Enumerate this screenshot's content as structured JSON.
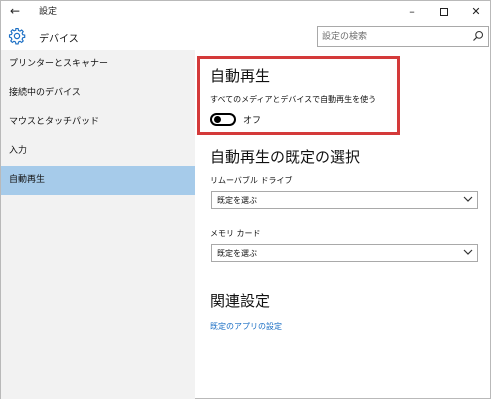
{
  "window": {
    "title": "設定"
  },
  "header": {
    "title": "デバイス",
    "search_placeholder": "設定の検索"
  },
  "sidebar": {
    "items": [
      {
        "label": "プリンターとスキャナー"
      },
      {
        "label": "接続中のデバイス"
      },
      {
        "label": "マウスとタッチパッド"
      },
      {
        "label": "入力"
      },
      {
        "label": "自動再生"
      }
    ],
    "selected": "自動再生"
  },
  "autoplay": {
    "title": "自動再生",
    "toggle_description": "すべてのメディアとデバイスで自動再生を使う",
    "toggle_state": "オフ"
  },
  "defaults": {
    "title": "自動再生の既定の選択",
    "removable_drive": {
      "label": "リムーバブル ドライブ",
      "value": "既定を選ぶ"
    },
    "memory_card": {
      "label": "メモリ カード",
      "value": "既定を選ぶ"
    }
  },
  "related": {
    "title": "関連設定",
    "link": "既定のアプリの設定"
  },
  "colors": {
    "selected_item": "#a6cbea",
    "link": "#1a6ec4",
    "highlight": "#d43a3a",
    "sidebar_bg": "#f2f2f2"
  }
}
